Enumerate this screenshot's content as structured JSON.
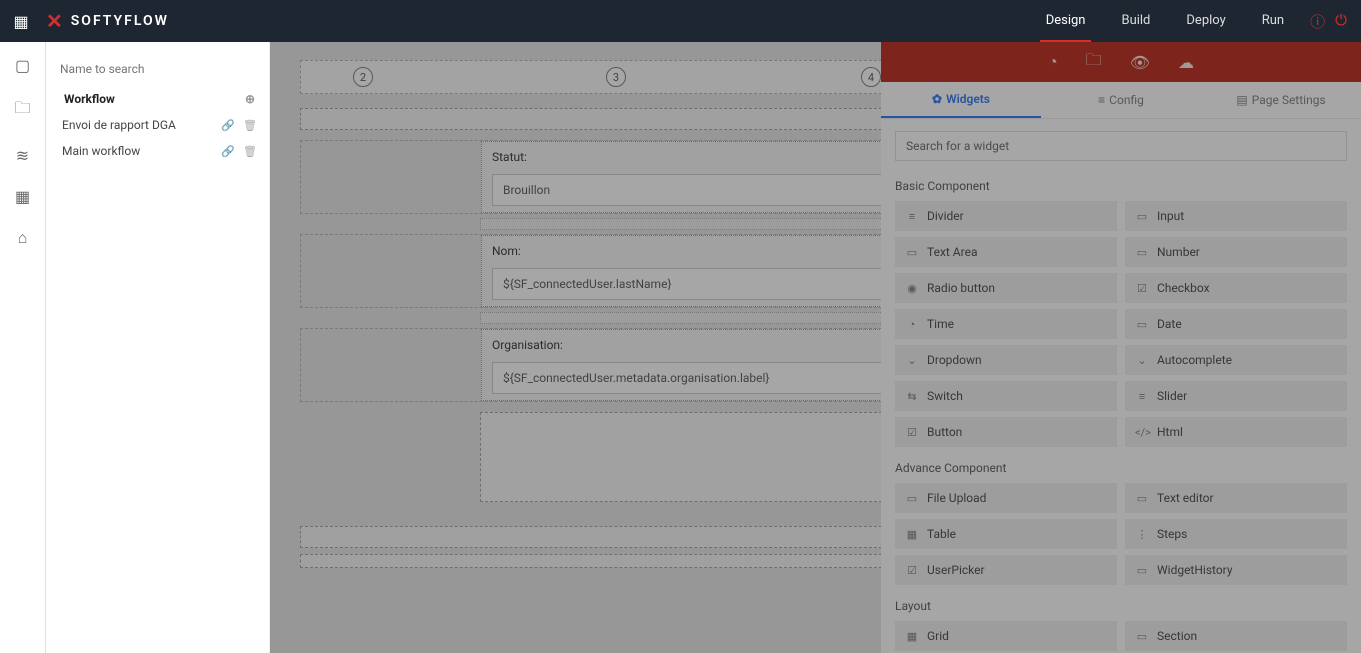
{
  "brand": "SOFTYFLOW",
  "nav": {
    "design": "Design",
    "build": "Build",
    "deploy": "Deploy",
    "run": "Run"
  },
  "explorer": {
    "search_placeholder": "Name to search",
    "section": "Workflow",
    "items": [
      {
        "label": "Envoi de rapport DGA"
      },
      {
        "label": "Main workflow"
      }
    ]
  },
  "steps": [
    "2",
    "3",
    "4"
  ],
  "fields": [
    {
      "label": "Statut:",
      "value": "Brouillon"
    },
    {
      "label": "Nom:",
      "value": "${SF_connectedUser.lastName}"
    },
    {
      "label": "Organisation:",
      "value": "${SF_connectedUser.metadata.organisation.label}"
    }
  ],
  "right": {
    "tabs": {
      "widgets": "Widgets",
      "config": "Config",
      "page": "Page Settings"
    },
    "search_placeholder": "Search for a widget",
    "cat_basic": "Basic Component",
    "cat_advance": "Advance Component",
    "cat_layout": "Layout",
    "basic": [
      "Divider",
      "Input",
      "Text Area",
      "Number",
      "Radio button",
      "Checkbox",
      "Time",
      "Date",
      "Dropdown",
      "Autocomplete",
      "Switch",
      "Slider",
      "Button",
      "Html"
    ],
    "basic_icons": [
      "≡",
      "▭",
      "▭",
      "▭",
      "◉",
      "☑",
      "◔",
      "▭",
      "⌄",
      "⌄",
      "⇆",
      "≡",
      "☑",
      "</>"
    ],
    "advance": [
      "File Upload",
      "Text editor",
      "Table",
      "Steps",
      "UserPicker",
      "WidgetHistory"
    ],
    "advance_icons": [
      "▭",
      "▭",
      "▦",
      "⋮",
      "☑",
      "▭"
    ],
    "layout": [
      "Grid",
      "Section"
    ],
    "layout_icons": [
      "▦",
      "▭"
    ]
  }
}
